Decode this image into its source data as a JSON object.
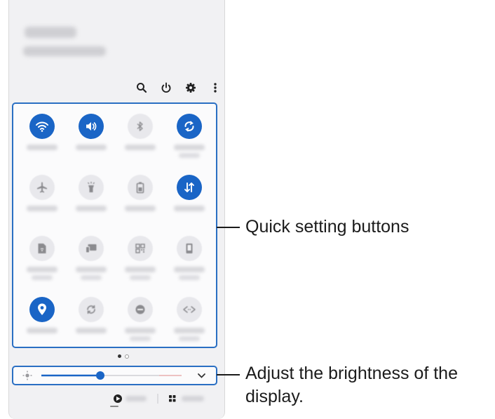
{
  "status_header": {
    "time_blurred": "",
    "date_blurred": ""
  },
  "toolbar": {
    "icons": [
      "search-icon",
      "power-icon",
      "gear-icon",
      "more-vertical-icon"
    ]
  },
  "quick_settings": {
    "tiles": [
      {
        "icon": "wifi-icon",
        "active": true
      },
      {
        "icon": "sound-icon",
        "active": true
      },
      {
        "icon": "bluetooth-icon",
        "active": false
      },
      {
        "icon": "auto-rotate-icon",
        "active": true
      },
      {
        "icon": "airplane-icon",
        "active": false
      },
      {
        "icon": "flashlight-icon",
        "active": false
      },
      {
        "icon": "power-saving-icon",
        "active": false
      },
      {
        "icon": "mobile-data-icon",
        "active": true
      },
      {
        "icon": "mobile-hotspot-icon",
        "active": false
      },
      {
        "icon": "smart-view-icon",
        "active": false
      },
      {
        "icon": "qr-scanner-icon",
        "active": false
      },
      {
        "icon": "device-icon",
        "active": false
      },
      {
        "icon": "location-icon",
        "active": true
      },
      {
        "icon": "sync-icon",
        "active": false
      },
      {
        "icon": "do-not-disturb-icon",
        "active": false
      },
      {
        "icon": "nfc-icon",
        "active": false
      }
    ],
    "page_indicator": {
      "pages": 2,
      "current": 1
    }
  },
  "brightness": {
    "level": 0.42
  },
  "colors": {
    "accent": "#1a65c6",
    "frame_blue": "#2a6fc3",
    "panel_bg": "#f1f1f3"
  },
  "callouts": {
    "quick_settings_label": "Quick setting buttons",
    "brightness_label_line1": "Adjust the brightness of the",
    "brightness_label_line2": "display."
  }
}
